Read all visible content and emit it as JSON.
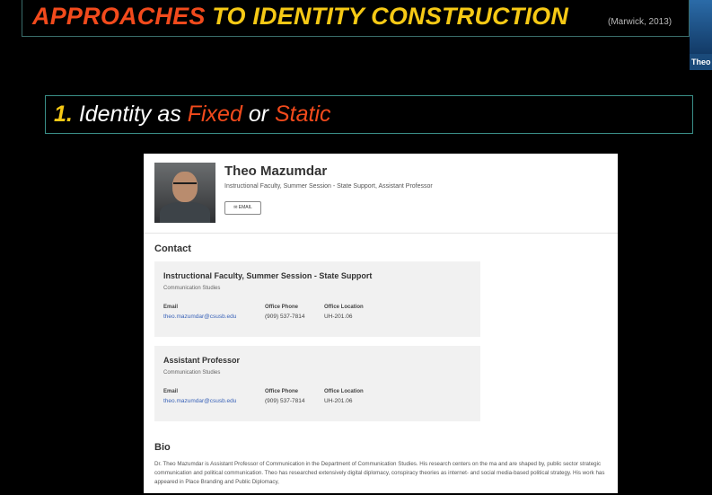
{
  "slide": {
    "title_part1": "APPROACHES",
    "title_part2": "TO IDENTITY CONSTRUCTION",
    "citation": "(Marwick, 2013)",
    "subtitle_number": "1.",
    "subtitle_text1": "Identity as",
    "subtitle_word1": "Fixed",
    "subtitle_text2": "or",
    "subtitle_word2": "Static"
  },
  "participant": {
    "name": "Theo"
  },
  "profile": {
    "name": "Theo Mazumdar",
    "role": "Instructional Faculty, Summer Session - State Support, Assistant Professor",
    "email_button": "EMAIL",
    "contact_heading": "Contact",
    "contacts": [
      {
        "title": "Instructional Faculty, Summer Session - State Support",
        "department": "Communication Studies",
        "email_label": "Email",
        "email": "theo.mazumdar@csusb.edu",
        "phone_label": "Office Phone",
        "phone": "(909) 537-7814",
        "location_label": "Office Location",
        "location": "UH-201.06"
      },
      {
        "title": "Assistant Professor",
        "department": "Communication Studies",
        "email_label": "Email",
        "email": "theo.mazumdar@csusb.edu",
        "phone_label": "Office Phone",
        "phone": "(909) 537-7814",
        "location_label": "Office Location",
        "location": "UH-201.06"
      }
    ],
    "bio_heading": "Bio",
    "bio_text": "Dr. Theo Mazumdar is Assistant Professor of Communication in the Department of Communication Studies. His research centers on the ma and are shaped by, public sector strategic communication and political communication. Theo has researched extensively digital diplomacy, conspiracy theories as internet- and social media-based political strategy. His work has appeared in Place Branding and Public Diplomacy,"
  },
  "colors": {
    "orange": "#f24a1c",
    "yellow": "#f6c915",
    "frame": "#3a8f88",
    "link": "#3a63b8"
  }
}
